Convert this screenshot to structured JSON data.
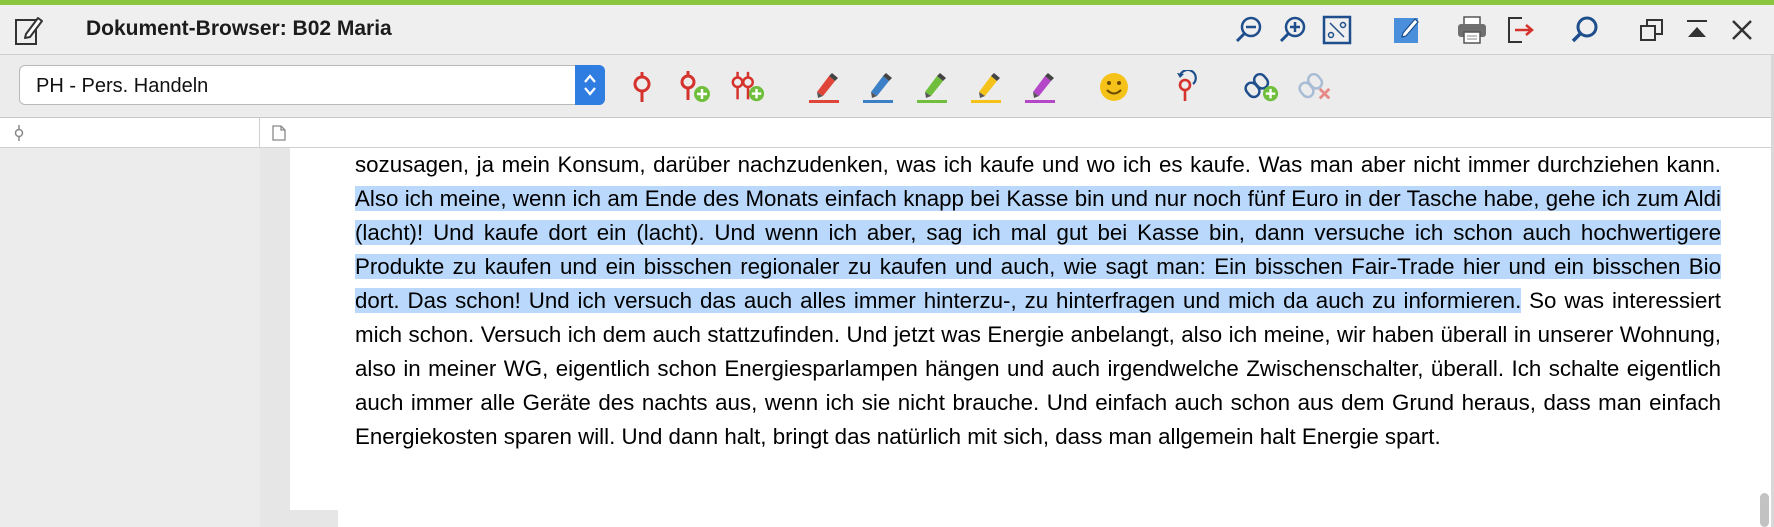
{
  "window": {
    "title": "Dokument-Browser: B02 Maria"
  },
  "toolbar": {
    "code_select_value": "PH - Pers. Handeln",
    "highlight_colors": [
      "#e0453a",
      "#3b7fc6",
      "#6fbe3c",
      "#f5c21a",
      "#b347c8"
    ]
  },
  "document": {
    "text_before": "sozusagen, ja mein Konsum, darüber nachzudenken, was ich kaufe und wo ich es kaufe. Was man aber nicht immer durchziehen kann. ",
    "text_selected": "Also ich meine, wenn ich am Ende des Monats einfach knapp bei Kasse bin und nur noch fünf Euro in der Tasche habe, gehe ich zum Aldi (lacht)! Und kaufe dort ein (lacht). Und wenn ich aber, sag ich mal gut bei Kasse bin, dann versuche ich schon auch hochwertigere Produkte zu kaufen und ein bisschen regionaler zu kaufen und auch, wie sagt man: Ein bisschen Fair-Trade hier und ein bisschen Bio dort. Das schon! Und ich versuch das auch alles immer hinterzu-, zu hinterfragen und mich da auch zu informieren.",
    "text_after": " So was interessiert mich schon. Versuch ich dem auch stattzufinden. Und jetzt was Energie anbelangt, also ich meine, wir haben überall in unserer Wohnung, also in meiner WG, eigentlich schon Energiesparlampen hängen und auch irgendwelche Zwischenschalter, überall. Ich schalte eigentlich auch immer alle Geräte des nachts aus, wenn ich sie nicht brauche. Und einfach auch schon aus dem Grund heraus, dass man einfach Energiekosten sparen will. Und dann halt, bringt das natürlich mit sich, dass man allgemein halt Energie spart.",
    "selection_color": "#b9d8fb"
  },
  "scroll": {
    "position": 0.95
  }
}
